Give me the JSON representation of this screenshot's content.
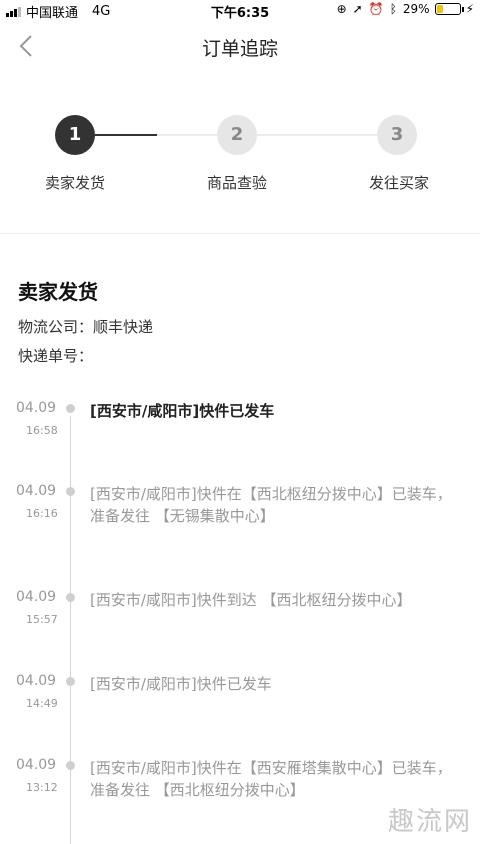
{
  "status_bar": {
    "carrier": "中国联通",
    "network": "4G",
    "time": "下午6:35",
    "battery": "29%",
    "battery_level": 0.29
  },
  "nav": {
    "title": "订单追踪"
  },
  "steps": [
    {
      "number": "1",
      "label": "卖家发货",
      "active": true
    },
    {
      "number": "2",
      "label": "商品查验",
      "active": false
    },
    {
      "number": "3",
      "label": "发往买家",
      "active": false
    }
  ],
  "shipping": {
    "title": "卖家发货",
    "carrier_line": "物流公司：顺丰快递",
    "tracking_line": "快递单号："
  },
  "timeline": [
    {
      "date": "04.09",
      "time": "16:58",
      "text": "[西安市/咸阳市]快件已发车"
    },
    {
      "date": "04.09",
      "time": "16:16",
      "text": "[西安市/咸阳市]快件在【西北枢纽分拨中心】已装车，准备发往 【无锡集散中心】"
    },
    {
      "date": "04.09",
      "time": "15:57",
      "text": "[西安市/咸阳市]快件到达 【西北枢纽分拨中心】"
    },
    {
      "date": "04.09",
      "time": "14:49",
      "text": "[西安市/咸阳市]快件已发车"
    },
    {
      "date": "04.09",
      "time": "13:12",
      "text": "[西安市/咸阳市]快件在【西安雁塔集散中心】已装车，准备发往 【西北枢纽分拨中心】"
    }
  ],
  "watermark": "趣流网",
  "colors": {
    "active_step": "#333333",
    "inactive_step": "#e6e6e6",
    "muted_text": "#999999",
    "battery": "#f5c400"
  }
}
